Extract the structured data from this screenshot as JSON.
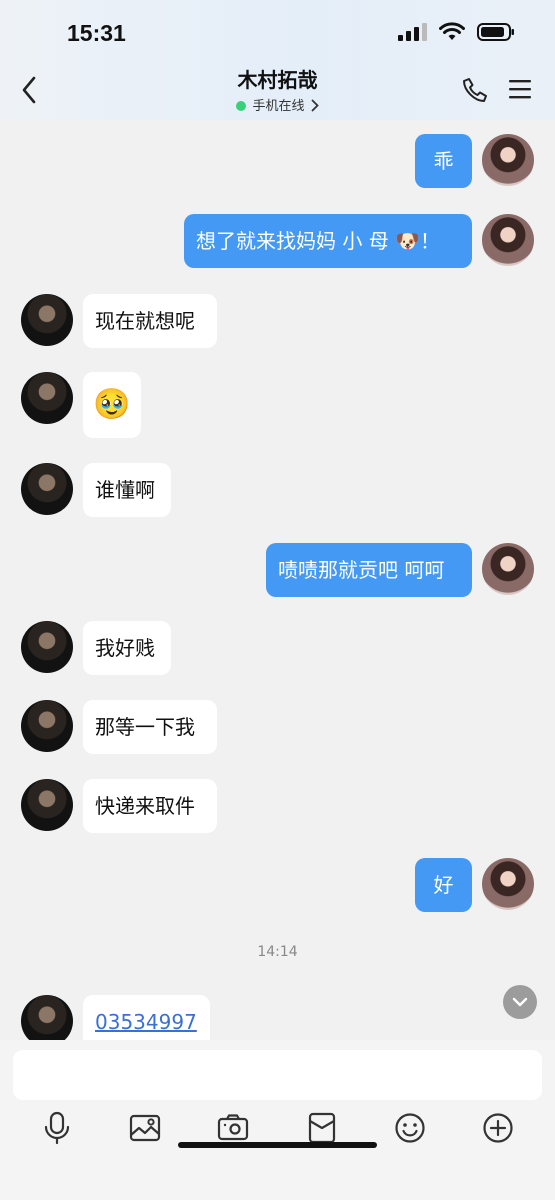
{
  "status": {
    "time": "15:31"
  },
  "header": {
    "title": "木村拓哉",
    "subtitle": "手机在线"
  },
  "messages": [
    {
      "sender": "me",
      "text": "乖"
    },
    {
      "sender": "me",
      "text": "想了就来找妈妈 小 母 🐶！"
    },
    {
      "sender": "them",
      "text": "现在就想呢"
    },
    {
      "sender": "them",
      "text": "🥹"
    },
    {
      "sender": "them",
      "text": "谁懂啊"
    },
    {
      "sender": "me",
      "text": "啧啧那就贡吧 呵呵"
    },
    {
      "sender": "them",
      "text": "我好贱"
    },
    {
      "sender": "them",
      "text": "那等一下我"
    },
    {
      "sender": "them",
      "text": "快递来取件"
    },
    {
      "sender": "me",
      "text": "好"
    },
    {
      "timestamp": "14:14"
    },
    {
      "sender": "them",
      "text": "03534997",
      "type": "link"
    }
  ],
  "toolbar": {
    "icons": [
      "mic-icon",
      "image-icon",
      "camera-icon",
      "red-packet-icon",
      "emoji-icon",
      "plus-icon"
    ]
  },
  "colors": {
    "my_bubble": "#4499f5",
    "their_bubble": "#ffffff",
    "online": "#39d07a",
    "link": "#3b6fd4"
  }
}
